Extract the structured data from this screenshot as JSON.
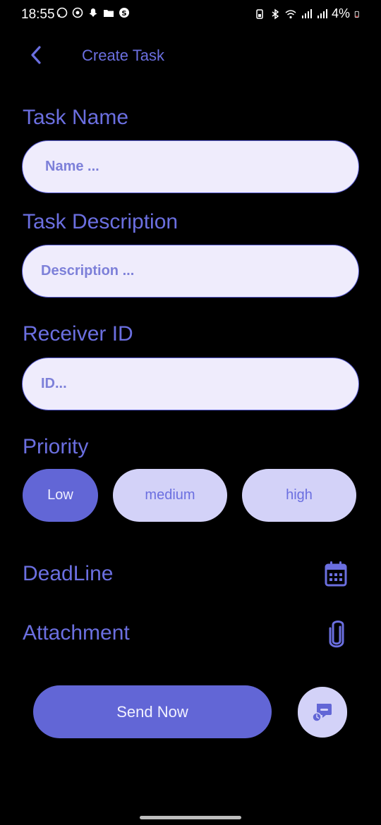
{
  "status_bar": {
    "time": "18:55",
    "battery": "4%"
  },
  "app_bar": {
    "title": "Create Task"
  },
  "form": {
    "task_name_label": "Task Name",
    "task_name_placeholder": "Name ...",
    "task_description_label": "Task Description",
    "task_description_placeholder": "Description ...",
    "receiver_id_label": "Receiver ID",
    "receiver_id_placeholder": "ID...",
    "priority_label": "Priority",
    "priority_options": [
      "Low",
      "medium",
      "high"
    ],
    "priority_selected": "Low",
    "deadline_label": "DeadLine",
    "attachment_label": "Attachment"
  },
  "actions": {
    "send_label": "Send Now"
  },
  "icons": {
    "back": "back-arrow-icon",
    "deadline": "calendar-icon",
    "attachment": "paperclip-icon",
    "chat": "scheduled-message-icon"
  },
  "colors": {
    "accent": "#6266d6",
    "text_accent": "#6b6fe0",
    "field_bg": "#efecfc",
    "chip_bg": "#d3d2f8",
    "background": "#000000"
  }
}
